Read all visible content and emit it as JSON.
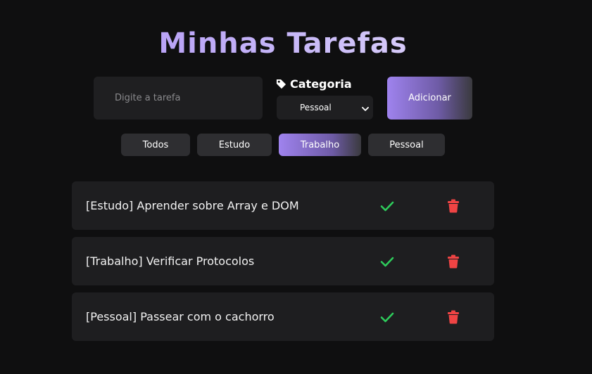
{
  "app": {
    "title": "Minhas Tarefas"
  },
  "form": {
    "task_placeholder": "Digite a tarefa",
    "task_value": "",
    "category_label": "Categoria",
    "category_selected": "Pessoal",
    "add_label": "Adicionar"
  },
  "filters": [
    {
      "label": "Todos",
      "active": false
    },
    {
      "label": "Estudo",
      "active": false
    },
    {
      "label": "Trabalho",
      "active": true
    },
    {
      "label": "Pessoal",
      "active": false
    }
  ],
  "tasks": [
    {
      "text": "[Estudo] Aprender sobre Array e DOM"
    },
    {
      "text": "[Trabalho] Verificar Protocolos"
    },
    {
      "text": "[Pessoal] Passear com o cachorro"
    }
  ],
  "icons": {
    "category": "tag-icon",
    "complete": "check-icon",
    "delete": "trash-icon"
  },
  "colors": {
    "accent": "#9f83ee",
    "check": "#2ecc5b",
    "delete": "#ef4444",
    "background": "#0f0f10",
    "card": "#1e1e20"
  }
}
